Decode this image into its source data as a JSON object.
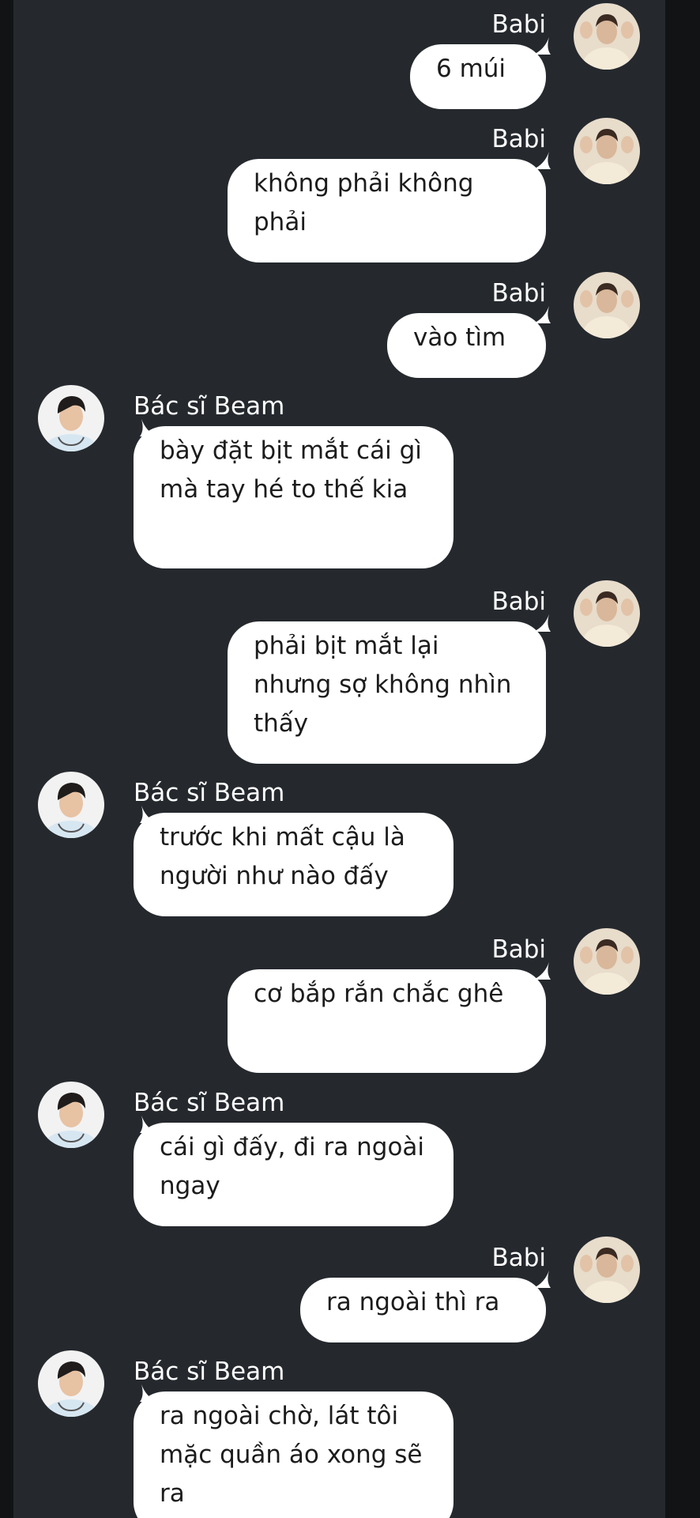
{
  "chat": {
    "messages": [
      {
        "side": "right",
        "sender": "Babi",
        "text": "6 múi"
      },
      {
        "side": "right",
        "sender": "Babi",
        "text": "không phải không phải"
      },
      {
        "side": "right",
        "sender": "Babi",
        "text": "vào tìm"
      },
      {
        "side": "left",
        "sender": "Bác sĩ Beam",
        "text": "bày đặt bịt mắt cái gì mà tay hé to thế kia"
      },
      {
        "side": "right",
        "sender": "Babi",
        "text": "phải bịt mắt lại nhưng sợ không nhìn thấy"
      },
      {
        "side": "left",
        "sender": "Bác sĩ Beam",
        "text": "trước khi mất cậu là người như nào đấy"
      },
      {
        "side": "right",
        "sender": "Babi",
        "text": "cơ bắp rắn chắc ghê"
      },
      {
        "side": "left",
        "sender": "Bác sĩ Beam",
        "text": "cái gì đấy, đi ra ngoài ngay"
      },
      {
        "side": "right",
        "sender": "Babi",
        "text": "ra ngoài thì ra"
      },
      {
        "side": "left",
        "sender": "Bác sĩ Beam",
        "text": "ra ngoài chờ, lát tôi mặc quần áo xong sẽ ra"
      }
    ]
  },
  "colors": {
    "background": "#25292e",
    "bubble": "#ffffff",
    "text": "#1c1c1c",
    "sender_text": "#ffffff"
  },
  "icons": {
    "babi_avatar": "babi-avatar",
    "beam_avatar": "doctor-beam-avatar"
  }
}
